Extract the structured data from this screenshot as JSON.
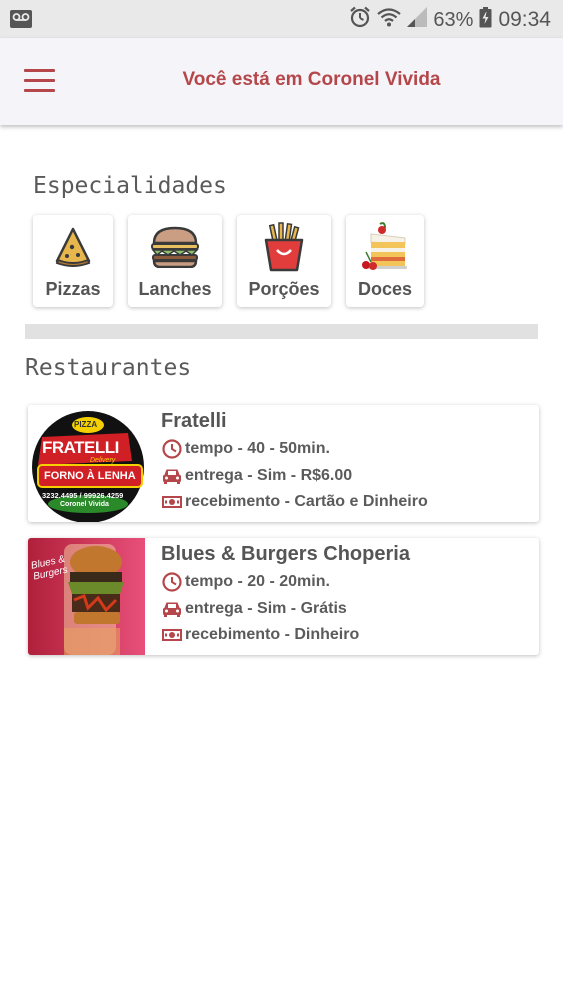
{
  "status_bar": {
    "battery": "63%",
    "time": "09:34",
    "icons": [
      "voicemail-icon",
      "alarm-icon",
      "wifi-icon",
      "signal-icon",
      "battery-icon"
    ]
  },
  "header": {
    "title": "Você está em Coronel Vivida",
    "menu_icon": "hamburger-menu-icon",
    "accent_color": "#b5474b"
  },
  "specialties": {
    "title": "Especialidades",
    "items": [
      {
        "label": "Pizzas",
        "icon": "pizza-slice-icon"
      },
      {
        "label": "Lanches",
        "icon": "burger-icon"
      },
      {
        "label": "Porções",
        "icon": "fries-icon"
      },
      {
        "label": "Doces",
        "icon": "cake-icon"
      }
    ]
  },
  "restaurants": {
    "title": "Restaurantes",
    "items": [
      {
        "name": "Fratelli",
        "time": "tempo - 40 - 50min.",
        "delivery": "entrega - Sim - R$6.00",
        "payment": "recebimento - Cartão e Dinheiro",
        "logo": {
          "top": "PIZZA",
          "brand": "FRATELLI",
          "sub": "Delivery",
          "banner": "FORNO À LENHA",
          "phones": "3232.4495 / 99926.4259",
          "city": "Coronel Vivida"
        }
      },
      {
        "name": "Blues & Burgers Choperia",
        "time": "tempo - 20 - 20min.",
        "delivery": "entrega - Sim - Grátis",
        "payment": "recebimento - Dinheiro",
        "logo": {
          "script": "Blues & Burgers"
        }
      }
    ]
  }
}
